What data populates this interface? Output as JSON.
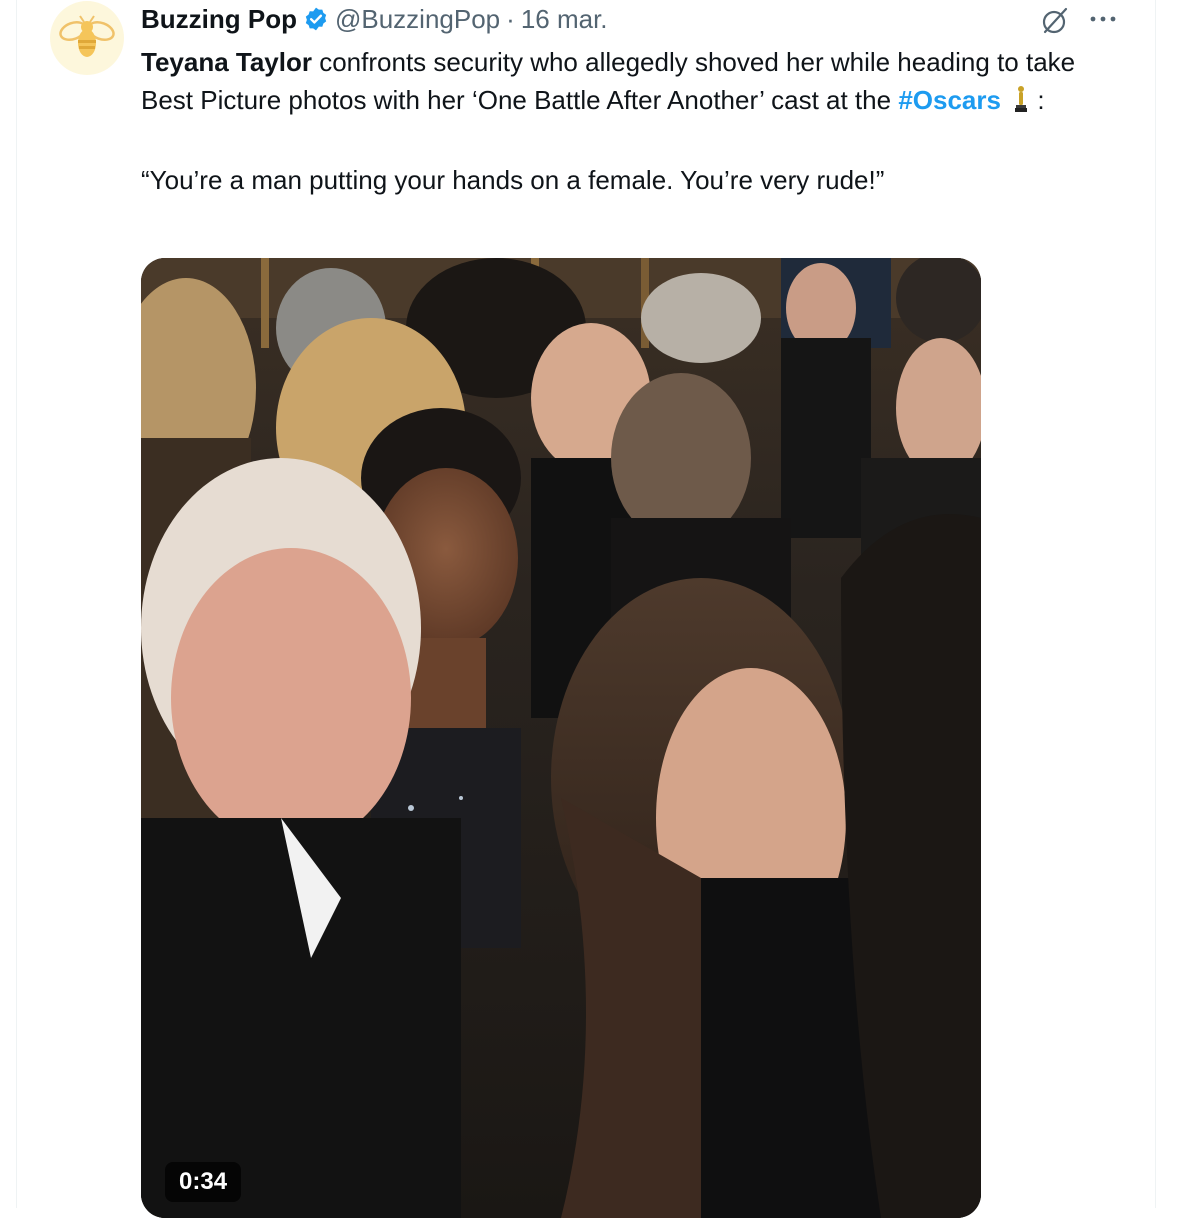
{
  "tweet": {
    "author_name": "Buzzing Pop",
    "handle": "@BuzzingPop",
    "separator": "·",
    "date": "16 mar.",
    "text_name": "Teyana Taylor",
    "text_part1": " confronts security who allegedly shoved her while heading to take Best Picture photos with her ‘One Battle After Another’ cast at the ",
    "hashtag": "#Oscars",
    "text_after_hashtag": " :",
    "quote": "“You’re a man putting your hands on a female. You’re very rude!”"
  },
  "media": {
    "video_duration": "0:34"
  },
  "icons": {
    "avatar": "bee-logo-icon",
    "verified": "verified-badge-icon",
    "grok": "grok-icon",
    "more": "more-options-icon",
    "hashtag_emoji": "oscar-trophy-icon"
  },
  "colors": {
    "accent": "#1d9bf0",
    "text": "#0f1419",
    "secondary": "#536471",
    "avatar_bg": "#fdf7dc"
  }
}
